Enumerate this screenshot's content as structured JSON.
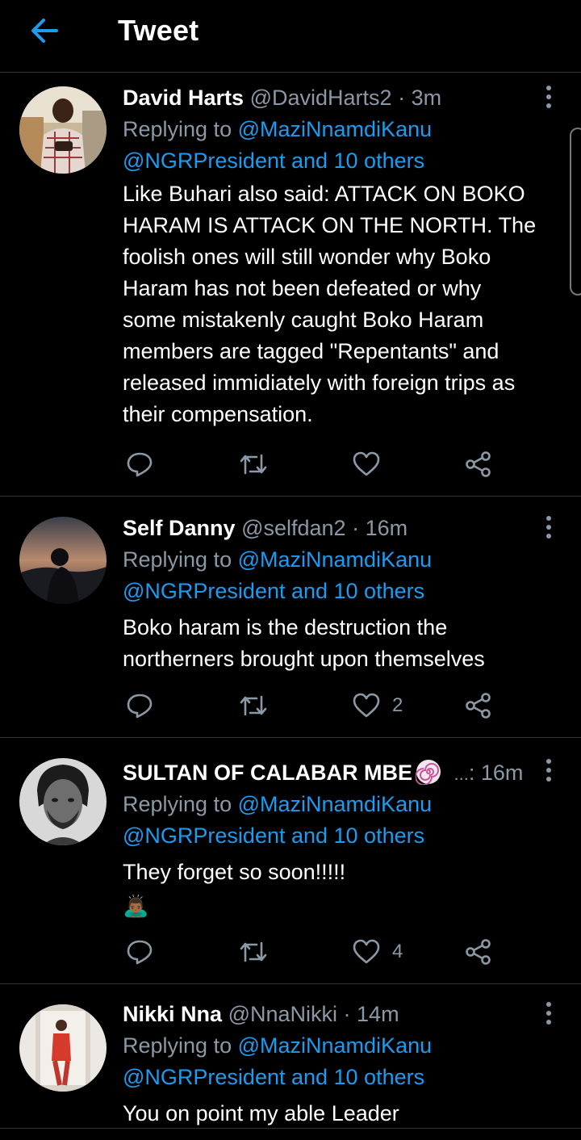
{
  "header": {
    "title": "Tweet"
  },
  "colors": {
    "accent": "#1d9bf0",
    "muted": "#8b98a5",
    "divider": "#2f3336"
  },
  "tweets": [
    {
      "name": "David Harts",
      "handle": "@DavidHarts2",
      "sep": "·",
      "time": "3m",
      "replying_prefix": "Replying to",
      "reply_to": "@MaziNnamdiKanu",
      "reply_line2": "@NGRPresident and 10 others",
      "lines": [
        "Like Buhari also said: ATTACK ON BOKO",
        "HARAM IS ATTACK ON THE NORTH. The",
        "foolish ones will still wonder why Boko",
        "Haram has not been defeated or why",
        "some mistakenly caught Boko Haram",
        "members are tagged \"Repentants\" and",
        "released immidiately with foreign trips as",
        "their compensation."
      ],
      "likes": ""
    },
    {
      "name": "Self Danny",
      "handle": "@selfdan2",
      "sep": "·",
      "time": "16m",
      "replying_prefix": "Replying to",
      "reply_to": "@MaziNnamdiKanu",
      "reply_line2": "@NGRPresident and 10 others",
      "lines": [
        "Boko haram is the destruction the",
        "northerners brought upon themselves"
      ],
      "likes": "2"
    },
    {
      "name": "SULTAN OF CALABAR MBE",
      "handle": "...",
      "sep": ":",
      "time": "16m",
      "replying_prefix": "Replying to",
      "reply_to": "@MaziNnamdiKanu",
      "reply_line2": "@NGRPresident and 10 others",
      "lines": [
        "They forget so soon!!!!!"
      ],
      "emoji": "🙇🏾‍♂️",
      "likes": "4"
    },
    {
      "name": "Nikki Nna",
      "handle": "@NnaNikki",
      "sep": "·",
      "time": "14m",
      "replying_prefix": "Replying to",
      "reply_to": "@MaziNnamdiKanu",
      "reply_line2": "@NGRPresident and 10 others",
      "lines": [
        "You on point my able Leader"
      ],
      "likes": ""
    }
  ]
}
